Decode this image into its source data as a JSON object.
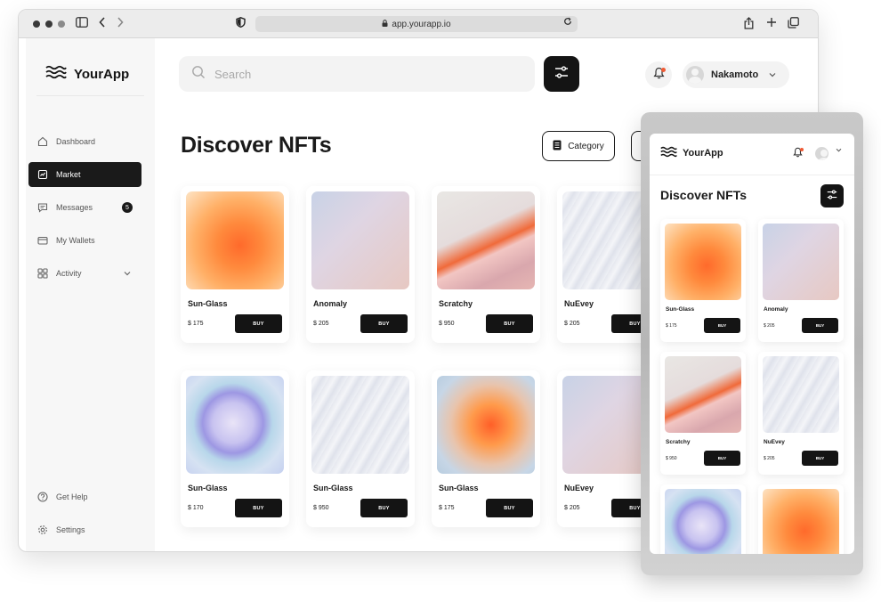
{
  "browser": {
    "url": "app.yourapp.io"
  },
  "sidebar": {
    "brand": "YourApp",
    "items": [
      {
        "label": "Dashboard"
      },
      {
        "label": "Market"
      },
      {
        "label": "Messages",
        "badge": "5"
      },
      {
        "label": "My Wallets"
      },
      {
        "label": "Activity"
      }
    ],
    "footer": [
      {
        "label": "Get Help"
      },
      {
        "label": "Settings"
      }
    ]
  },
  "header": {
    "search_placeholder": "Search",
    "user_name": "Nakamoto"
  },
  "main": {
    "title": "Discover NFTs",
    "category_label": "Category",
    "buy_label": "BUY",
    "cards": [
      {
        "name": "Sun-Glass",
        "price": "$ 175",
        "art": "art-sun"
      },
      {
        "name": "Anomaly",
        "price": "$ 205",
        "art": "art-anom"
      },
      {
        "name": "Scratchy",
        "price": "$ 950",
        "art": "art-scratch"
      },
      {
        "name": "NuEvey",
        "price": "$ 205",
        "art": "art-wave"
      },
      {
        "name": "Sun-Glass",
        "price": "$ 170",
        "art": "art-sphere"
      },
      {
        "name": "Sun-Glass",
        "price": "$ 950",
        "art": "art-wave"
      },
      {
        "name": "Sun-Glass",
        "price": "$ 175",
        "art": "art-orb"
      },
      {
        "name": "NuEvey",
        "price": "$ 205",
        "art": "art-anom"
      }
    ]
  },
  "mobile": {
    "brand": "YourApp",
    "title": "Discover NFTs",
    "buy_label": "BUY",
    "cards": [
      {
        "name": "Sun-Glass",
        "price": "$ 175",
        "art": "art-sun"
      },
      {
        "name": "Anomaly",
        "price": "$ 205",
        "art": "art-anom"
      },
      {
        "name": "Scratchy",
        "price": "$ 950",
        "art": "art-scratch"
      },
      {
        "name": "NuEvey",
        "price": "$ 205",
        "art": "art-wave"
      },
      {
        "name": "",
        "price": "",
        "art": "art-sphere"
      },
      {
        "name": "",
        "price": "",
        "art": "art-sun"
      }
    ]
  },
  "colors": {
    "primary_dark": "#141414",
    "accent_orange": "#ef5a34",
    "sidebar_bg": "#f7f7f7"
  }
}
